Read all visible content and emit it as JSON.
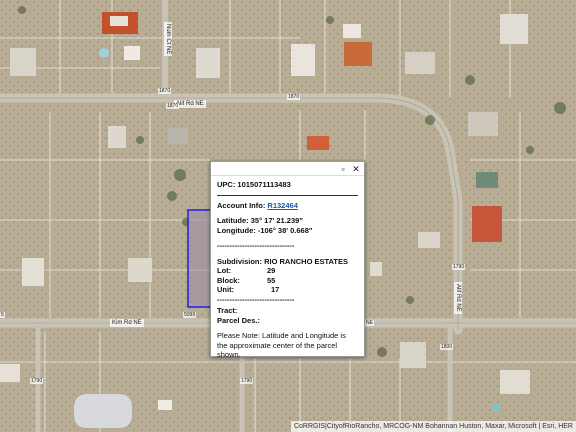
{
  "map": {
    "road_labels": {
      "alif_top": "Alif Rd NE",
      "num_ct": "Num Ct NE",
      "kim_rd": "Kim Rd NE",
      "alif_right": "Alif Rd NE"
    },
    "address_numbers": {
      "a1": "1870",
      "a2": "1870",
      "a3": "1870",
      "a4": "5099",
      "a5": "5",
      "a6": "1790",
      "a7": "1790",
      "a8": "1800",
      "a9": "1790",
      "a10": "NE"
    },
    "attribution": "CoRRGIS|CityofRioRancho, MRCOG-NM Bohannan Huston, Maxar, Microsoft | Esri, HER"
  },
  "popup": {
    "maximize_icon": "▫",
    "close_icon": "✕",
    "upc": "UPC: 1015071113483",
    "account_label": "Account Info: ",
    "account_link": "R132464",
    "latitude": "Latitude: 35° 17' 21.239\"",
    "longitude": "Longitude: -106° 38' 0.668\"",
    "separator1": "-------------------------------",
    "subdivision": "Subdivision: RIO RANCHO ESTATES",
    "lot_label": "Lot:",
    "lot_value": "29",
    "block_label": "Block:",
    "block_value": "55",
    "unit_label": "Unit:",
    "unit_value": "17",
    "separator2": "-------------------------------",
    "tract": "Tract:",
    "parcel_desc": "Parcel Des.:",
    "note": "Please Note: Latitude and Longitude is the approximate center of the parcel shown."
  }
}
